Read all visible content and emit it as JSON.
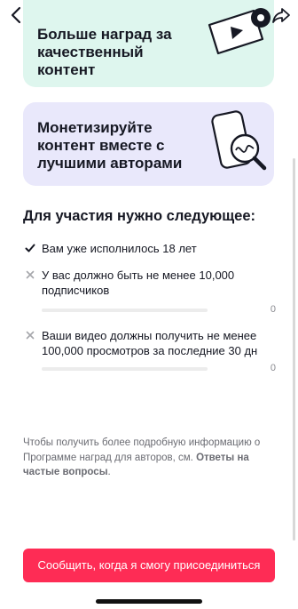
{
  "cards": [
    {
      "title": "Больше наград за\nкачественный\nконтент",
      "color": "#def6ee"
    },
    {
      "title": "Монетизируйте\nконтент вместе с\nлучшими авторами",
      "color": "#e9e8fb"
    }
  ],
  "requirements": {
    "title": "Для участия нужно следующее:",
    "items": [
      {
        "text": "Вам уже исполнилось 18 лет",
        "met": true
      },
      {
        "text": "У вас должно быть не менее 10,000\nподписчиков",
        "met": false,
        "progress_value": "0",
        "progress_fraction": 0
      },
      {
        "text": "Ваши видео должны получить не менее\n100,000 просмотров за последние 30 дн",
        "met": false,
        "progress_value": "0",
        "progress_fraction": 0
      }
    ]
  },
  "info": {
    "text": "Чтобы получить более подробную информацию о Программе наград для авторов, см. ",
    "link": "Ответы на частые вопросы",
    "suffix": "."
  },
  "cta": {
    "label": "Сообщить, когда я смогу присоединиться"
  },
  "colors": {
    "accent": "#fe2c55",
    "card_green": "#def6ee",
    "card_purple": "#e9e8fb"
  },
  "icons": {
    "back": "chevron-left-icon",
    "share": "share-arrow-icon"
  }
}
